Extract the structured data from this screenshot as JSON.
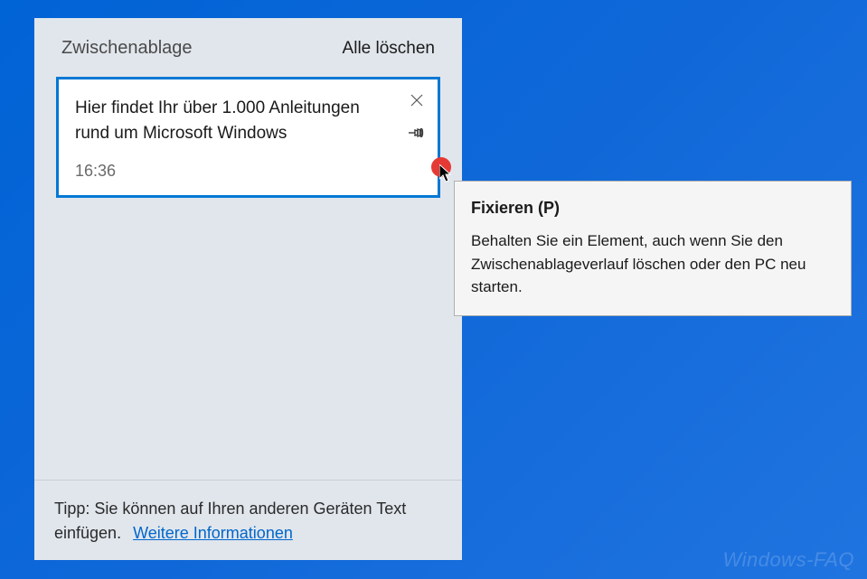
{
  "panel": {
    "title": "Zwischenablage",
    "clear_all": "Alle löschen"
  },
  "item": {
    "text": "Hier findet Ihr über 1.000 Anleitungen rund um Microsoft Windows",
    "time": "16:36"
  },
  "footer": {
    "tip_prefix": "Tipp: Sie können auf Ihren anderen Geräten Text einfügen.",
    "more_info": "Weitere Informationen"
  },
  "tooltip": {
    "title": "Fixieren (P)",
    "body": "Behalten Sie ein Element, auch wenn Sie den Zwischenablageverlauf löschen oder den PC neu starten."
  },
  "watermark": "Windows-FAQ"
}
